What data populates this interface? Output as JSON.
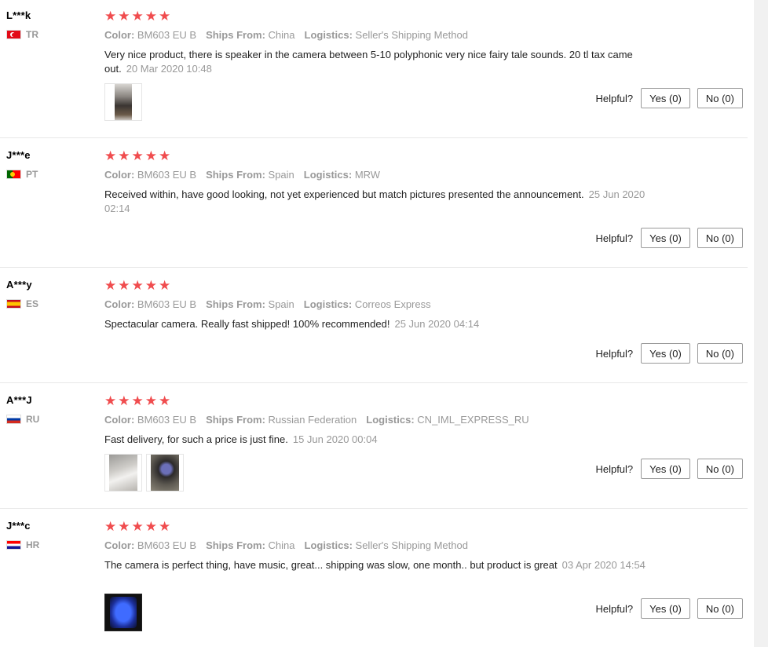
{
  "labels": {
    "color": "Color:",
    "ships_from": "Ships From:",
    "logistics": "Logistics:",
    "helpful": "Helpful?"
  },
  "reviews": [
    {
      "user": "L***k",
      "country": "TR",
      "stars": 5,
      "color": "BM603 EU B",
      "ships_from": "China",
      "logistics": "Seller's Shipping Method",
      "text": "Very nice product, there is speaker in the camera between 5-10 polyphonic very nice fairy tale sounds. 20 tl tax came out.",
      "date": "20 Mar 2020 10:48",
      "yes": "Yes (0)",
      "no": "No (0)",
      "photos": 1
    },
    {
      "user": "J***e",
      "country": "PT",
      "stars": 5,
      "color": "BM603 EU B",
      "ships_from": "Spain",
      "logistics": "MRW",
      "text": "Received within, have good looking, not yet experienced but match pictures presented the announcement.",
      "date": "25 Jun 2020 02:14",
      "yes": "Yes (0)",
      "no": "No (0)",
      "photos": 0
    },
    {
      "user": "A***y",
      "country": "ES",
      "stars": 5,
      "color": "BM603 EU B",
      "ships_from": "Spain",
      "logistics": "Correos Express",
      "text": "Spectacular camera. Really fast shipped! 100% recommended!",
      "date": "25 Jun 2020 04:14",
      "yes": "Yes (0)",
      "no": "No (0)",
      "photos": 0
    },
    {
      "user": "A***J",
      "country": "RU",
      "stars": 5,
      "color": "BM603 EU B",
      "ships_from": "Russian Federation",
      "logistics": "CN_IML_EXPRESS_RU",
      "text": "Fast delivery, for such a price is just fine.",
      "date": "15 Jun 2020 00:04",
      "yes": "Yes (0)",
      "no": "No (0)",
      "photos": 2
    },
    {
      "user": "J***c",
      "country": "HR",
      "stars": 5,
      "color": "BM603 EU B",
      "ships_from": "China",
      "logistics": "Seller's Shipping Method",
      "text": "The camera is perfect thing, have music, great... shipping was slow, one month.. but product is great",
      "date": "03 Apr 2020 14:54",
      "yes": "Yes (0)",
      "no": "No (0)",
      "photos": 1
    }
  ],
  "colors": {
    "star": "#f04c4e",
    "muted_text": "#999999",
    "body_text": "#222222",
    "divider": "#e8e8e8"
  }
}
